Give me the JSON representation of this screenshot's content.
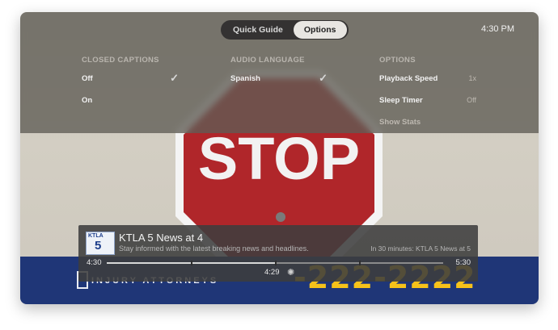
{
  "tabs": [
    {
      "label": "Quick Guide",
      "active": false
    },
    {
      "label": "Options",
      "active": true
    }
  ],
  "clock": "4:30 PM",
  "columns": {
    "closed_captions": {
      "heading": "CLOSED CAPTIONS",
      "items": [
        {
          "label": "Off",
          "selected": true
        },
        {
          "label": "On",
          "selected": false
        }
      ]
    },
    "audio_language": {
      "heading": "AUDIO LANGUAGE",
      "items": [
        {
          "label": "Spanish",
          "selected": true
        }
      ]
    },
    "options": {
      "heading": "OPTIONS",
      "items": [
        {
          "label": "Playback Speed",
          "value": "1x"
        },
        {
          "label": "Sleep Timer",
          "value": "Off"
        },
        {
          "label": "Show Stats",
          "value": ""
        }
      ]
    }
  },
  "now_playing": {
    "channel_logo_text": "KTLA",
    "channel_logo_number": "5",
    "title": "KTLA 5 News at 4",
    "description": "Stay informed with the latest breaking news and headlines.",
    "up_next": "In 30 minutes: KTLA 5 News at 5",
    "start_time": "4:30",
    "end_time": "5:30",
    "current_time": "4:29",
    "progress_fraction": 0.5
  },
  "scene": {
    "sign_text": "STOP",
    "banner_text": "INJURY ATTORNEYS",
    "banner_phone": "-222-2222"
  },
  "colors": {
    "banner": "#1f3677",
    "phone_yellow": "#f6c21a",
    "stop_red": "#b0262a"
  }
}
